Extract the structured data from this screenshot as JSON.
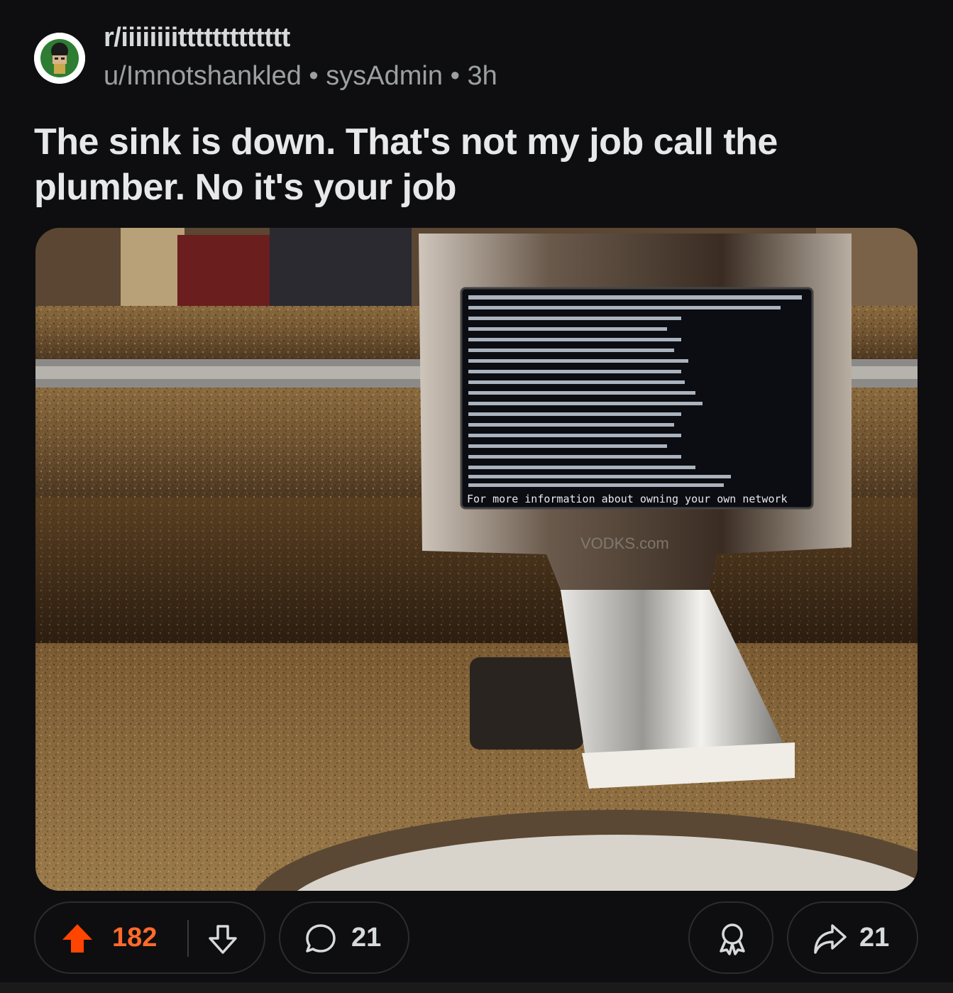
{
  "post": {
    "subreddit": "r/iiiiiiiittttttttttttt",
    "author": "u/Imnotshankled",
    "flair": "sysAdmin",
    "age": "3h",
    "separator": "•",
    "title": "The sink is down. That's not my job call the plumber. No it's your job"
  },
  "image": {
    "screen_lines": [
      "For more information about owning your own network"
    ],
    "watermark": "VODKS.com"
  },
  "actions": {
    "upvotes": "182",
    "comments": "21",
    "shares": "21",
    "upvote_state": "upvoted"
  },
  "colors": {
    "upvote": "#ff4500",
    "background": "#0e0e10"
  },
  "icons": [
    "upvote-icon",
    "downvote-icon",
    "comment-icon",
    "award-icon",
    "share-icon"
  ]
}
